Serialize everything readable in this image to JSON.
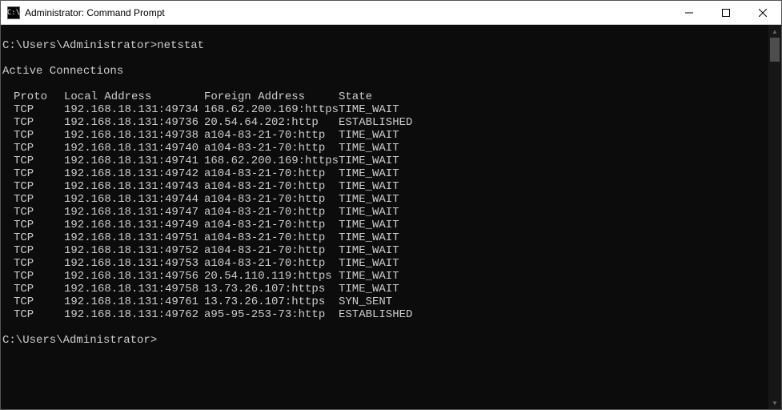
{
  "titlebar": {
    "icon_text": "C:\\",
    "title": "Administrator: Command Prompt"
  },
  "terminal": {
    "prompt1": "C:\\Users\\Administrator>",
    "command": "netstat",
    "section_header": "Active Connections",
    "columns": {
      "proto": "Proto",
      "local": "Local Address",
      "foreign": "Foreign Address",
      "state": "State"
    },
    "rows": [
      {
        "proto": "TCP",
        "local": "192.168.18.131:49734",
        "foreign": "168.62.200.169:https",
        "state": "TIME_WAIT"
      },
      {
        "proto": "TCP",
        "local": "192.168.18.131:49736",
        "foreign": "20.54.64.202:http",
        "state": "ESTABLISHED"
      },
      {
        "proto": "TCP",
        "local": "192.168.18.131:49738",
        "foreign": "a104-83-21-70:http",
        "state": "TIME_WAIT"
      },
      {
        "proto": "TCP",
        "local": "192.168.18.131:49740",
        "foreign": "a104-83-21-70:http",
        "state": "TIME_WAIT"
      },
      {
        "proto": "TCP",
        "local": "192.168.18.131:49741",
        "foreign": "168.62.200.169:https",
        "state": "TIME_WAIT"
      },
      {
        "proto": "TCP",
        "local": "192.168.18.131:49742",
        "foreign": "a104-83-21-70:http",
        "state": "TIME_WAIT"
      },
      {
        "proto": "TCP",
        "local": "192.168.18.131:49743",
        "foreign": "a104-83-21-70:http",
        "state": "TIME_WAIT"
      },
      {
        "proto": "TCP",
        "local": "192.168.18.131:49744",
        "foreign": "a104-83-21-70:http",
        "state": "TIME_WAIT"
      },
      {
        "proto": "TCP",
        "local": "192.168.18.131:49747",
        "foreign": "a104-83-21-70:http",
        "state": "TIME_WAIT"
      },
      {
        "proto": "TCP",
        "local": "192.168.18.131:49749",
        "foreign": "a104-83-21-70:http",
        "state": "TIME_WAIT"
      },
      {
        "proto": "TCP",
        "local": "192.168.18.131:49751",
        "foreign": "a104-83-21-70:http",
        "state": "TIME_WAIT"
      },
      {
        "proto": "TCP",
        "local": "192.168.18.131:49752",
        "foreign": "a104-83-21-70:http",
        "state": "TIME_WAIT"
      },
      {
        "proto": "TCP",
        "local": "192.168.18.131:49753",
        "foreign": "a104-83-21-70:http",
        "state": "TIME_WAIT"
      },
      {
        "proto": "TCP",
        "local": "192.168.18.131:49756",
        "foreign": "20.54.110.119:https",
        "state": "TIME_WAIT"
      },
      {
        "proto": "TCP",
        "local": "192.168.18.131:49758",
        "foreign": "13.73.26.107:https",
        "state": "TIME_WAIT"
      },
      {
        "proto": "TCP",
        "local": "192.168.18.131:49761",
        "foreign": "13.73.26.107:https",
        "state": "SYN_SENT"
      },
      {
        "proto": "TCP",
        "local": "192.168.18.131:49762",
        "foreign": "a95-95-253-73:http",
        "state": "ESTABLISHED"
      }
    ],
    "prompt2": "C:\\Users\\Administrator>"
  }
}
